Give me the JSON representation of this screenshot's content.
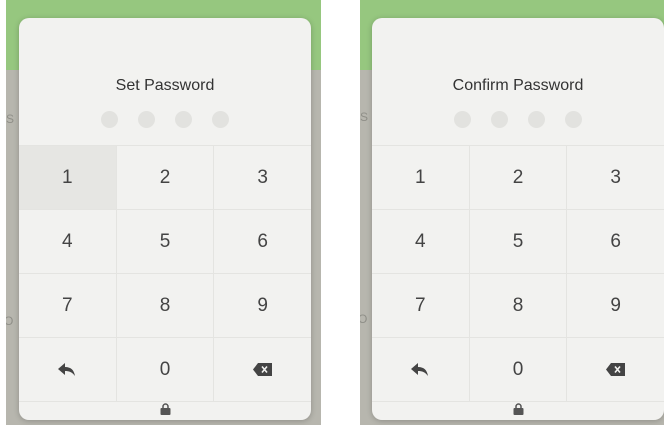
{
  "colors": {
    "background_green": "#96c77f",
    "overlay_gray": "#b7b6ae",
    "dialog_bg": "#f2f2f0",
    "pin_dot_empty": "#e2e2df",
    "key_pressed_bg": "#e6e6e3"
  },
  "screens": [
    {
      "title": "Set Password",
      "pin_dots_filled": 0,
      "pin_dots_total": 4,
      "pressed_key": "1",
      "bg_text": [
        "S",
        "O"
      ],
      "keys": [
        [
          "1",
          "2",
          "3"
        ],
        [
          "4",
          "5",
          "6"
        ],
        [
          "7",
          "8",
          "9"
        ],
        [
          "back-arrow-icon",
          "0",
          "backspace-icon"
        ]
      ],
      "footer_icon": "lock-icon"
    },
    {
      "title": "Confirm Password",
      "pin_dots_filled": 0,
      "pin_dots_total": 4,
      "pressed_key": "",
      "bg_text": [
        "S",
        "O"
      ],
      "keys": [
        [
          "1",
          "2",
          "3"
        ],
        [
          "4",
          "5",
          "6"
        ],
        [
          "7",
          "8",
          "9"
        ],
        [
          "back-arrow-icon",
          "0",
          "backspace-icon"
        ]
      ],
      "footer_icon": "lock-icon"
    }
  ]
}
